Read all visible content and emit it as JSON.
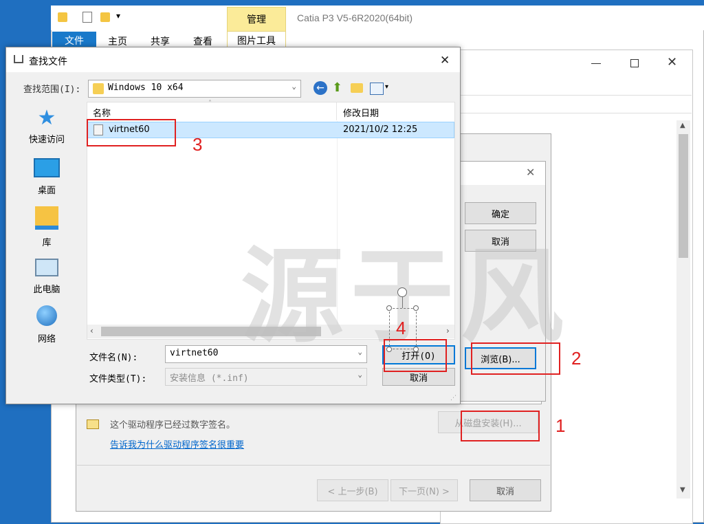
{
  "explorer": {
    "title": "Catia P3 V5-6R2020(64bit)",
    "ribbon_tab_active": "文件",
    "ribbon_tabs": [
      "主页",
      "共享",
      "查看"
    ],
    "context_header": "管理",
    "context_tab": "图片工具"
  },
  "find_dialog": {
    "title": "查找文件",
    "look_in_label": "查找范围(I):",
    "look_in_value": "Windows 10 x64",
    "nav": [
      "快速访问",
      "桌面",
      "库",
      "此电脑",
      "网络"
    ],
    "columns": {
      "name": "名称",
      "date": "修改日期"
    },
    "files": [
      {
        "name": "virtnet60",
        "date": "2021/10/2 12:25"
      }
    ],
    "filename_label": "文件名(N):",
    "filename_value": "virtnet60",
    "filetype_label": "文件类型(T):",
    "filetype_value": "安装信息 (*.inf)",
    "open_label": "打开(O)",
    "cancel_label": "取消"
  },
  "install_disk_dialog": {
    "ok_label": "确定",
    "cancel_label": "取消",
    "browse_label": "浏览(B)..."
  },
  "wizard": {
    "signed_text": "这个驱动程序已经过数字签名。",
    "why_link": "告诉我为什么驱动程序签名很重要",
    "have_disk_label": "从磁盘安装(H)...",
    "back_label": "< 上一步(B)",
    "next_label": "下一页(N) >",
    "cancel_label": "取消"
  },
  "annotations": [
    "1",
    "2",
    "3",
    "4"
  ],
  "watermark": "源于风",
  "colors": {
    "accent": "#0078d7",
    "annotation": "#e02020",
    "selection": "#cce8ff"
  }
}
